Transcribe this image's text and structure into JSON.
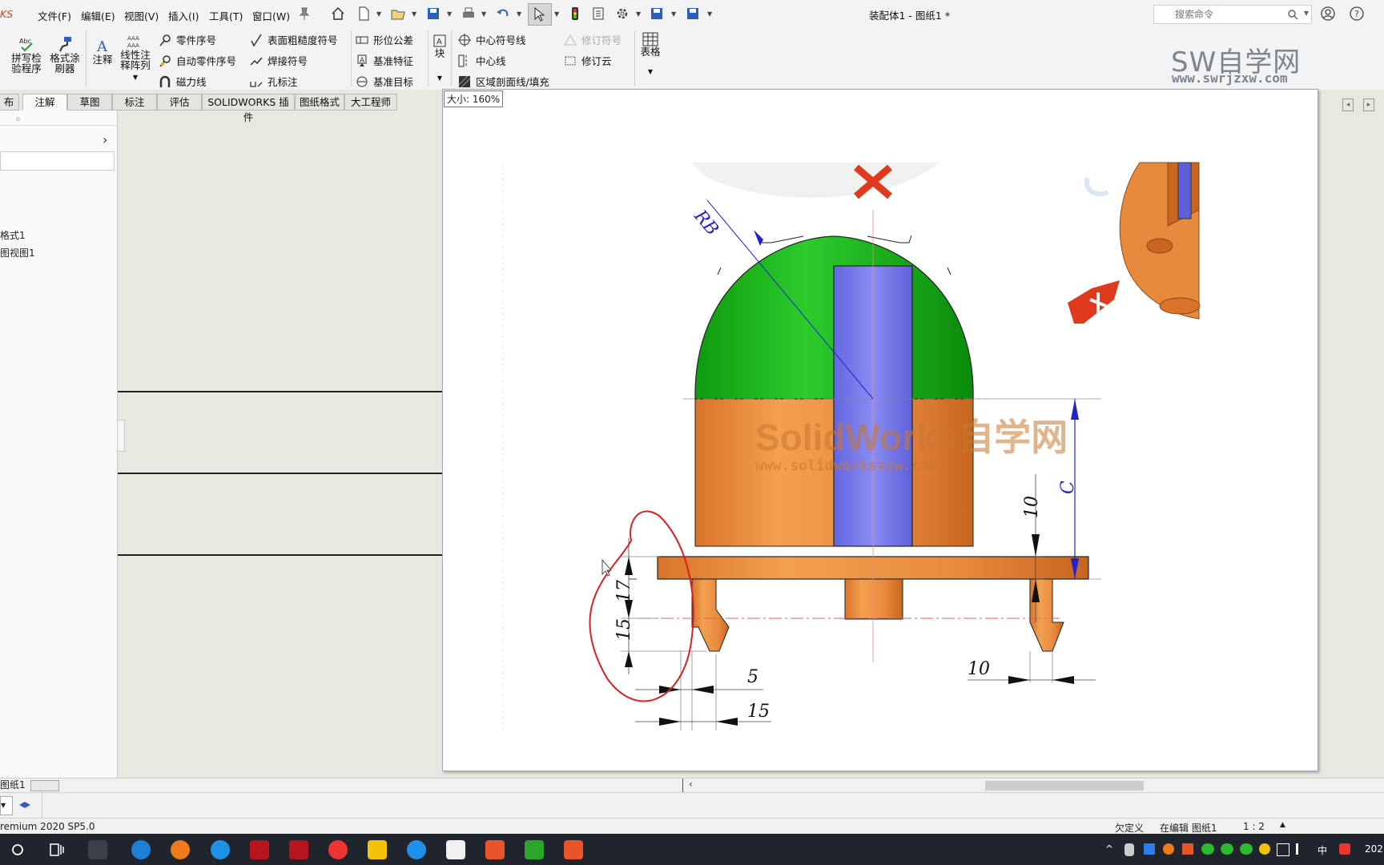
{
  "app": {
    "logo_fragment": "KS",
    "title": "装配体1 - 图纸1 *"
  },
  "menu": {
    "file": "文件(F)",
    "edit": "编辑(E)",
    "view": "视图(V)",
    "insert": "插入(I)",
    "tools": "工具(T)",
    "window": "窗口(W)"
  },
  "search": {
    "placeholder": "搜索命令"
  },
  "ribbon": {
    "spell_check": "拼写检\n验程序",
    "format_painter": "格式涂\n刷器",
    "note": "注释",
    "linear_note_pattern": "线性注\n释阵列",
    "balloon": "零件序号",
    "auto_balloon": "自动零件序号",
    "magnetic_line": "磁力线",
    "surface_finish": "表面粗糙度符号",
    "weld_symbol": "焊接符号",
    "hole_callout": "孔标注",
    "geometric_tolerance": "形位公差",
    "datum_feature": "基准特征",
    "datum_target": "基准目标",
    "block": "块",
    "center_mark": "中心符号线",
    "centerline": "中心线",
    "area_hatch": "区域剖面线/填充",
    "revision_symbol": "修订符号",
    "revision_cloud": "修订云",
    "table": "表格"
  },
  "tabs": [
    "布局",
    "注解",
    "草图",
    "标注",
    "评估",
    "SOLIDWORKS 插件",
    "图纸格式",
    "大工程师"
  ],
  "active_tab_index": 1,
  "watermark": {
    "brand": "SW自学网",
    "url": "www.swrjzxw.com",
    "center_brand": "SolidWorks自学网",
    "center_url": "www.solidworkszxw.com"
  },
  "left_panel": {
    "tree_items": [
      "格式1",
      "图视图1"
    ]
  },
  "zoom_label": "大小: 160%",
  "drawing": {
    "radius_label": "RB",
    "dim_c": "C",
    "dim_10_right": "10",
    "dim_17": "17",
    "dim_15_left": "15",
    "dim_5": "5",
    "dim_15_bottom": "15",
    "dim_10_bottom": "10"
  },
  "sheet_tab": "图纸1",
  "status": {
    "product": "remium 2020 SP5.0",
    "defined": "欠定义",
    "editing": "在编辑 图纸1",
    "scale": "1 : 2"
  },
  "tray": {
    "ime": "中",
    "year": "202"
  },
  "colors": {
    "dome": "#1fbf1f",
    "body": "#e8893e",
    "pin": "#7173e8",
    "dim_blue": "#2222cc",
    "annotation_red": "#d82020",
    "accent_red": "#e03a1e"
  }
}
